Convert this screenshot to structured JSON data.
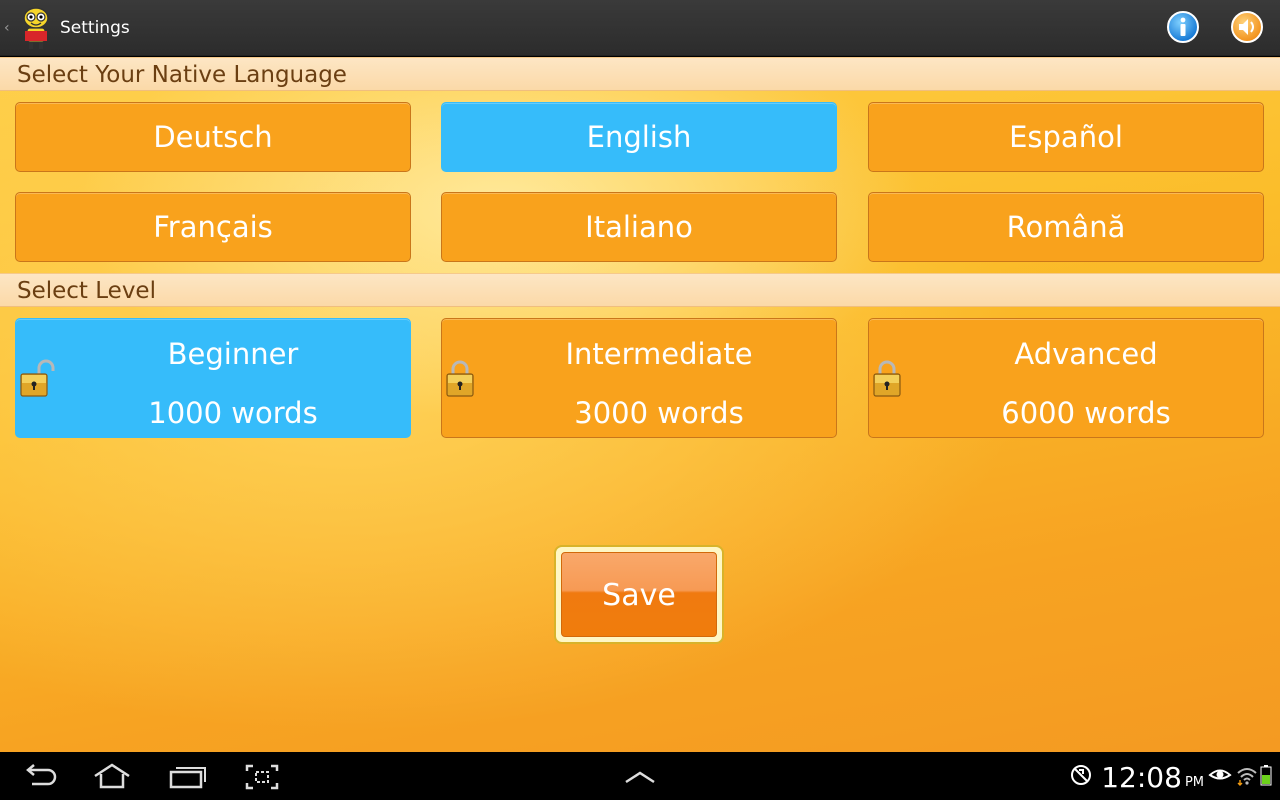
{
  "action_bar": {
    "title": "Settings",
    "icons": [
      "back-caret-icon",
      "app-logo-icon",
      "info-icon",
      "sound-icon"
    ]
  },
  "native_language": {
    "header": "Select Your Native Language",
    "selected": "English",
    "options": [
      {
        "label": "Deutsch",
        "selected": false
      },
      {
        "label": "English",
        "selected": true
      },
      {
        "label": "Español",
        "selected": false
      },
      {
        "label": "Français",
        "selected": false
      },
      {
        "label": "Italiano",
        "selected": false
      },
      {
        "label": "Română",
        "selected": false
      }
    ]
  },
  "level": {
    "header": "Select Level",
    "selected": "Beginner",
    "options": [
      {
        "name": "Beginner",
        "words": "1000 words",
        "selected": true,
        "icon": "unlocked-padlock-icon"
      },
      {
        "name": "Intermediate",
        "words": "3000 words",
        "selected": false,
        "icon": "locked-padlock-icon"
      },
      {
        "name": "Advanced",
        "words": "6000 words",
        "selected": false,
        "icon": "locked-padlock-icon"
      }
    ]
  },
  "save_label": "Save",
  "nav_bar": {
    "buttons": [
      "back-icon",
      "home-icon",
      "recent-apps-icon",
      "screenshot-icon",
      "expand-up-icon"
    ],
    "status": {
      "time": "12:08",
      "ampm": "PM",
      "icons": [
        "blocked-sync-icon",
        "eye-icon",
        "wifi-icon",
        "battery-icon"
      ]
    }
  },
  "colors": {
    "tile_orange": "#f9a21c",
    "tile_selected_blue": "#36bcfa",
    "header_text": "#6b3f12",
    "save_orange": "#f07a10"
  }
}
